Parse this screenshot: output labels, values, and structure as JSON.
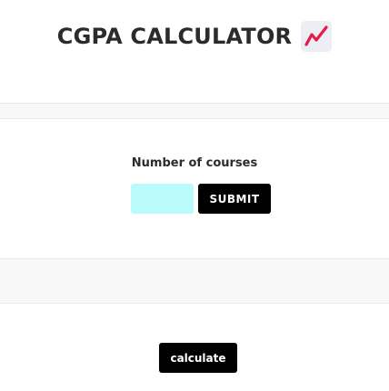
{
  "header": {
    "title": "CGPA CALCULATOR",
    "icon": "chart-increasing-icon"
  },
  "form": {
    "label": "Number of courses",
    "input_value": "",
    "input_placeholder": "",
    "submit_label": "SUBMIT"
  },
  "actions": {
    "calculate_label": "calculate"
  },
  "colors": {
    "input_background": "#b9fbfb",
    "button_background": "#000000",
    "band_background": "#f8f8f8"
  }
}
